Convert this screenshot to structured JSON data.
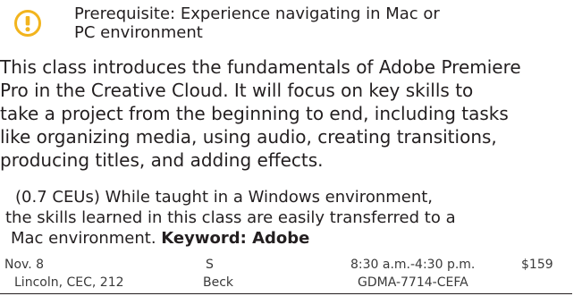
{
  "prerequisite": {
    "icon": "exclamation-circle-icon",
    "icon_color": "#f2b41d",
    "lines": [
      "Prerequisite: Experience navigating in Mac or",
      "PC environment"
    ]
  },
  "description": {
    "lines": [
      "This class introduces the fundamentals of Adobe Premiere",
      "Pro in the Creative Cloud. It will focus on key skills to",
      "take a project from the beginning to end, including tasks",
      "like organizing media, using audio, creating transitions,",
      "producing titles, and adding effects."
    ]
  },
  "ceu_note": {
    "lines": [
      "(0.7 CEUs) While taught in a Windows environment,",
      "the skills learned in this class are easily transferred to a",
      "Mac environment."
    ],
    "keyword": "Keyword: Adobe"
  },
  "schedule": {
    "date": "Nov. 8",
    "day": "S",
    "time": "8:30 a.m.-4:30 p.m.",
    "price": "$159",
    "location": "Lincoln, CEC, 212",
    "instructor": "Beck",
    "course_code": "GDMA-7714-CEFA"
  }
}
